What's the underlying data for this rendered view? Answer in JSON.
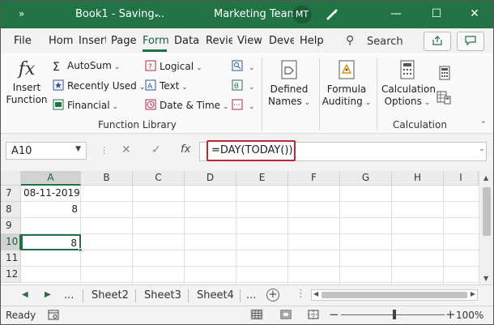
{
  "titlebar": {
    "qa_icon": "chevrons-right-icon",
    "doc_title": "Book1 - Saving...",
    "caret": "⌄",
    "team": "Marketing Team",
    "avatar_initials": "MT",
    "minimize": "—",
    "restore": "☐",
    "close": "✕",
    "bg_color": "#217346"
  },
  "tabs": {
    "items": [
      "File",
      "Home",
      "Insert",
      "Page",
      "Formulas",
      "Data",
      "Review",
      "View",
      "Developer",
      "Help"
    ],
    "active": "Formulas",
    "search": "Search"
  },
  "ribbon": {
    "function_library": {
      "label": "Function Library",
      "insert_function": [
        "Insert",
        "Function"
      ],
      "autosum": "AutoSum",
      "recently_used": "Recently Used",
      "financial": "Financial",
      "logical": "Logical",
      "text": "Text",
      "date_time": "Date & Time"
    },
    "defined_names": [
      "Defined",
      "Names"
    ],
    "formula_auditing": [
      "Formula",
      "Auditing"
    ],
    "calculation": {
      "label": "Calculation",
      "options": [
        "Calculation",
        "Options"
      ]
    }
  },
  "formula_bar": {
    "name_box": "A10",
    "formula": "=DAY(TODAY())"
  },
  "grid": {
    "columns": [
      "A",
      "B",
      "C",
      "D",
      "E",
      "F",
      "G",
      "H",
      "I"
    ],
    "selected_column": "A",
    "rows": [
      {
        "row": "7",
        "a": "08-11-2019",
        "align": "left"
      },
      {
        "row": "8",
        "a": "8",
        "align": "right"
      },
      {
        "row": "9",
        "a": "",
        "align": "right"
      },
      {
        "row": "10",
        "a": "8",
        "align": "right"
      },
      {
        "row": "11",
        "a": "",
        "align": "right"
      },
      {
        "row": "12",
        "a": "",
        "align": "right"
      }
    ],
    "selected_row": "10"
  },
  "sheets": {
    "more_left": "...",
    "tabs": [
      "Sheet2",
      "Sheet3",
      "Sheet4"
    ],
    "more_right": "...",
    "add": "+"
  },
  "status": {
    "ready": "Ready",
    "zoom": "100%"
  }
}
